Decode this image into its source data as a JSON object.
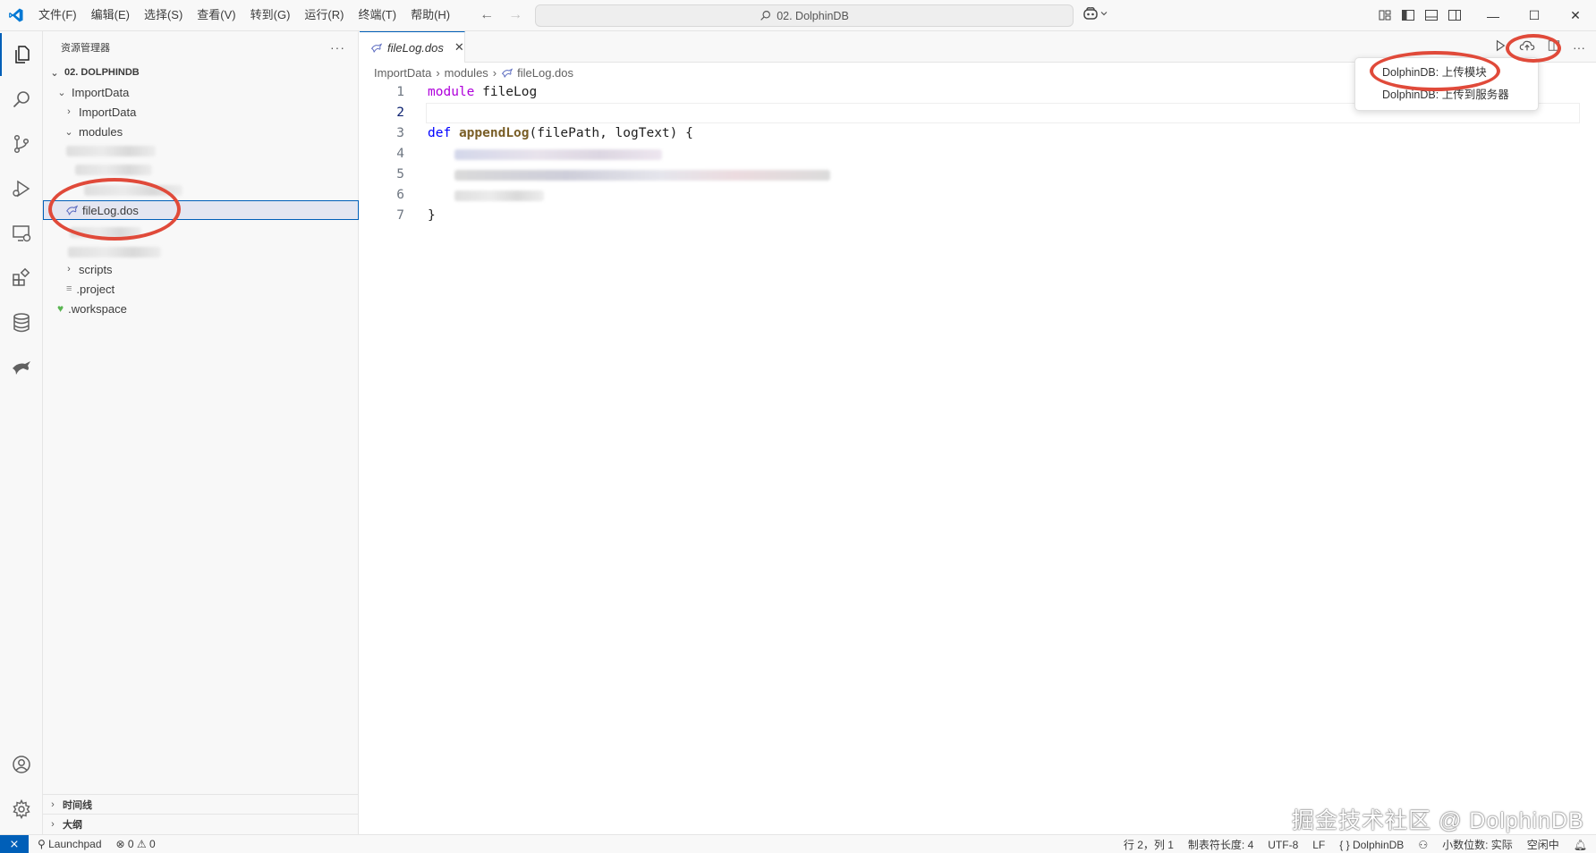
{
  "titlebar": {
    "menu": [
      "文件(F)",
      "编辑(E)",
      "选择(S)",
      "查看(V)",
      "转到(G)",
      "运行(R)",
      "终端(T)",
      "帮助(H)"
    ],
    "search_text": "02. DolphinDB"
  },
  "sidebar": {
    "title": "资源管理器",
    "more": "···",
    "workspace": "02. DOLPHINDB",
    "tree": {
      "importdata_root": "ImportData",
      "importdata_child": "ImportData",
      "modules": "modules",
      "selected_file": "fileLog.dos",
      "scripts": "scripts",
      "project": ".project",
      "workspace_file": ".workspace"
    },
    "bottom": {
      "timeline": "时间线",
      "outline": "大纲"
    }
  },
  "editor": {
    "tab_label": "fileLog.dos",
    "breadcrumb": [
      "ImportData",
      "modules",
      "fileLog.dos"
    ],
    "line_numbers": [
      "1",
      "2",
      "3",
      "4",
      "5",
      "6",
      "7"
    ],
    "code": {
      "l1_kw": "module",
      "l1_rest": " fileLog",
      "l3_kw": "def",
      "l3_fn": "appendLog",
      "l3_rest": "(filePath, logText) {",
      "l7": "}"
    }
  },
  "popup": {
    "items": [
      "DolphinDB: 上传模块",
      "DolphinDB: 上传到服务器"
    ]
  },
  "statusbar": {
    "launchpad": "Launchpad",
    "problems": "⊗ 0 ⚠ 0",
    "position": "行 2，列 1",
    "tab_size": "制表符长度: 4",
    "encoding": "UTF-8",
    "eol": "LF",
    "language": "{ } DolphinDB",
    "decimal": "小数位数: 实际",
    "idle": "空闲中"
  },
  "watermark": "掘金技术社区 @ DolphinDB",
  "colors": {
    "accent": "#005fb8",
    "annotation": "#e04a3a",
    "keyword": "#af00db",
    "function": "#795e26"
  }
}
